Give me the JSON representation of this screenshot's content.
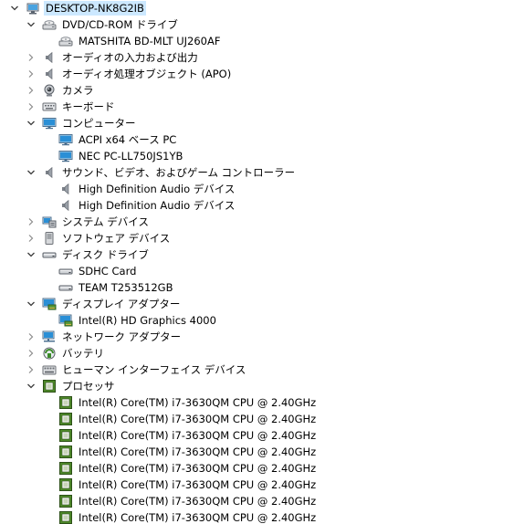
{
  "tree": {
    "nodes": [
      {
        "label": "DESKTOP-NK8G2IB",
        "level": 0,
        "state": "expanded",
        "icon": "computer-root-icon",
        "selected": true
      },
      {
        "label": "DVD/CD-ROM ドライブ",
        "level": 1,
        "state": "expanded",
        "icon": "optical-drive-icon"
      },
      {
        "label": "MATSHITA BD-MLT UJ260AF",
        "level": 2,
        "state": "leaf",
        "icon": "optical-drive-icon"
      },
      {
        "label": "オーディオの入力および出力",
        "level": 1,
        "state": "collapsed",
        "icon": "speaker-icon"
      },
      {
        "label": "オーディオ処理オブジェクト (APO)",
        "level": 1,
        "state": "collapsed",
        "icon": "speaker-icon"
      },
      {
        "label": "カメラ",
        "level": 1,
        "state": "collapsed",
        "icon": "camera-icon"
      },
      {
        "label": "キーボード",
        "level": 1,
        "state": "collapsed",
        "icon": "keyboard-icon"
      },
      {
        "label": "コンピューター",
        "level": 1,
        "state": "expanded",
        "icon": "monitor-icon"
      },
      {
        "label": "ACPI x64 ベース PC",
        "level": 2,
        "state": "leaf",
        "icon": "monitor-icon"
      },
      {
        "label": "NEC PC-LL750JS1YB",
        "level": 2,
        "state": "leaf",
        "icon": "monitor-icon"
      },
      {
        "label": "サウンド、ビデオ、およびゲーム コントローラー",
        "level": 1,
        "state": "expanded",
        "icon": "speaker-icon"
      },
      {
        "label": "High Definition Audio デバイス",
        "level": 2,
        "state": "leaf",
        "icon": "speaker-icon"
      },
      {
        "label": "High Definition Audio デバイス",
        "level": 2,
        "state": "leaf",
        "icon": "speaker-icon"
      },
      {
        "label": "システム デバイス",
        "level": 1,
        "state": "collapsed",
        "icon": "system-device-icon"
      },
      {
        "label": "ソフトウェア デバイス",
        "level": 1,
        "state": "collapsed",
        "icon": "software-device-icon"
      },
      {
        "label": "ディスク ドライブ",
        "level": 1,
        "state": "expanded",
        "icon": "disk-drive-icon"
      },
      {
        "label": "SDHC Card",
        "level": 2,
        "state": "leaf",
        "icon": "disk-drive-icon"
      },
      {
        "label": "TEAM T253512GB",
        "level": 2,
        "state": "leaf",
        "icon": "disk-drive-icon"
      },
      {
        "label": "ディスプレイ アダプター",
        "level": 1,
        "state": "expanded",
        "icon": "display-adapter-icon"
      },
      {
        "label": "Intel(R) HD Graphics 4000",
        "level": 2,
        "state": "leaf",
        "icon": "display-adapter-icon"
      },
      {
        "label": "ネットワーク アダプター",
        "level": 1,
        "state": "collapsed",
        "icon": "network-adapter-icon"
      },
      {
        "label": "バッテリ",
        "level": 1,
        "state": "collapsed",
        "icon": "battery-icon"
      },
      {
        "label": "ヒューマン インターフェイス デバイス",
        "level": 1,
        "state": "collapsed",
        "icon": "hid-icon"
      },
      {
        "label": "プロセッサ",
        "level": 1,
        "state": "expanded",
        "icon": "processor-icon"
      },
      {
        "label": "Intel(R) Core(TM) i7-3630QM CPU @ 2.40GHz",
        "level": 2,
        "state": "leaf",
        "icon": "processor-icon"
      },
      {
        "label": "Intel(R) Core(TM) i7-3630QM CPU @ 2.40GHz",
        "level": 2,
        "state": "leaf",
        "icon": "processor-icon"
      },
      {
        "label": "Intel(R) Core(TM) i7-3630QM CPU @ 2.40GHz",
        "level": 2,
        "state": "leaf",
        "icon": "processor-icon"
      },
      {
        "label": "Intel(R) Core(TM) i7-3630QM CPU @ 2.40GHz",
        "level": 2,
        "state": "leaf",
        "icon": "processor-icon"
      },
      {
        "label": "Intel(R) Core(TM) i7-3630QM CPU @ 2.40GHz",
        "level": 2,
        "state": "leaf",
        "icon": "processor-icon"
      },
      {
        "label": "Intel(R) Core(TM) i7-3630QM CPU @ 2.40GHz",
        "level": 2,
        "state": "leaf",
        "icon": "processor-icon"
      },
      {
        "label": "Intel(R) Core(TM) i7-3630QM CPU @ 2.40GHz",
        "level": 2,
        "state": "leaf",
        "icon": "processor-icon"
      },
      {
        "label": "Intel(R) Core(TM) i7-3630QM CPU @ 2.40GHz",
        "level": 2,
        "state": "leaf",
        "icon": "processor-icon"
      }
    ]
  },
  "colors": {
    "selection": "#cce8ff",
    "chevron": "#3c3c3c",
    "cpu_green": "#4f8a2a",
    "monitor_blue": "#2a8fd6"
  }
}
